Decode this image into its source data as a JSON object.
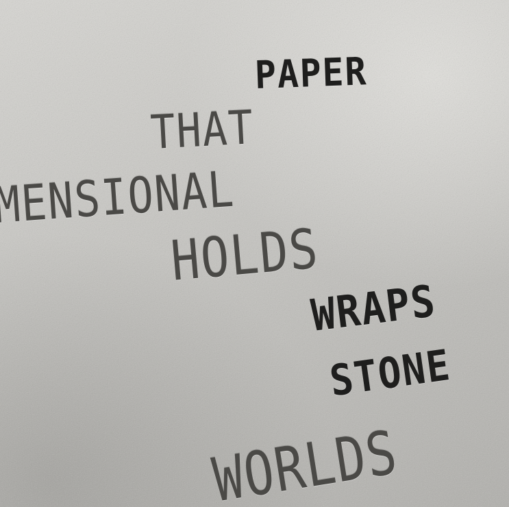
{
  "photo": {
    "words": {
      "paper": "PAPER",
      "that": "THAT",
      "mensional": "MENSIONAL",
      "holds": "HOLDS",
      "wraps": "WRAPS",
      "stone": "STONE",
      "worlds": "WORLDS"
    },
    "colors": {
      "paper_surface": "#c6c5c1",
      "bold_ink": "#1e1e1d",
      "light_ink": "#4a4946"
    }
  }
}
